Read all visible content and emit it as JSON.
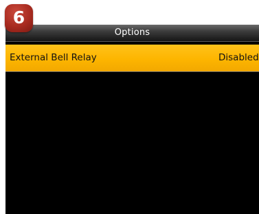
{
  "step_badge": {
    "number": "6",
    "color": "#a82b20"
  },
  "header": {
    "title": "Options"
  },
  "menu": {
    "items": [
      {
        "label": "External Bell Relay",
        "value": "Disabled",
        "highlight_color": "#fdb500"
      }
    ]
  }
}
